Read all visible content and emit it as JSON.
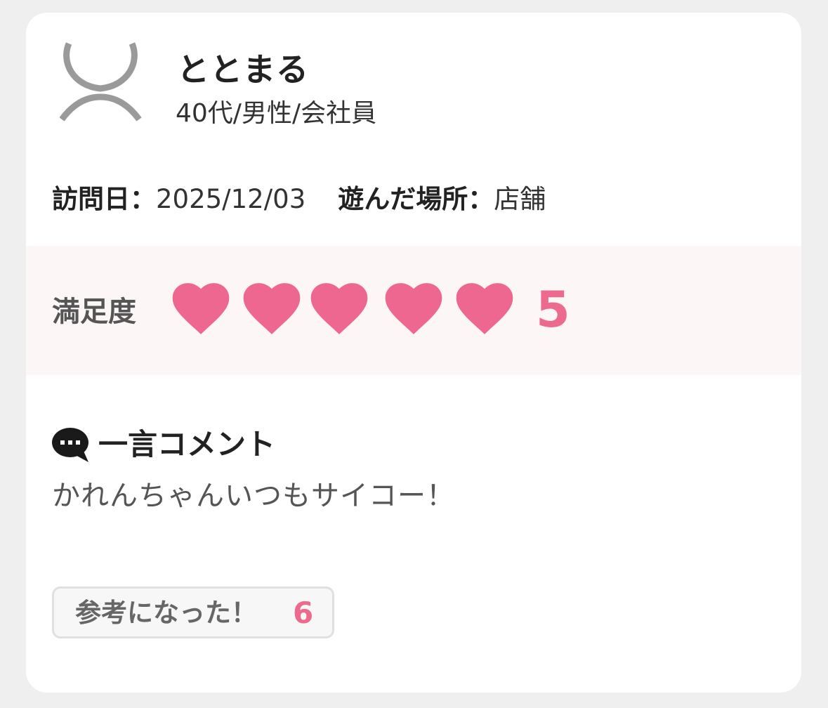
{
  "reviewer": {
    "name": "ととまる",
    "profile": "40代/男性/会社員",
    "avatar_icon": "user-silhouette-icon"
  },
  "visit": {
    "date_label": "訪問日：",
    "date_value": "2025/12/03",
    "place_label": "遊んだ場所：",
    "place_value": "店舗"
  },
  "satisfaction": {
    "label": "満足度",
    "score": "5",
    "hearts_filled": 5,
    "hearts_total": 5,
    "heart_color": "#ee6790"
  },
  "comment": {
    "icon": "speech-bubble-icon",
    "title": "一言コメント",
    "text": "かれんちゃんいつもサイコー！"
  },
  "helpful": {
    "label": "参考になった！",
    "count": "6"
  },
  "colors": {
    "accent": "#ec6a8d",
    "band": "#fdf6f7",
    "page_bg": "#efefef"
  }
}
